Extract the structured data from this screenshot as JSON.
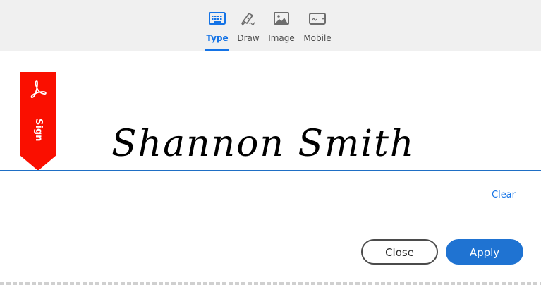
{
  "tabs": {
    "type": {
      "label": "Type",
      "icon": "keyboard-icon",
      "active": true
    },
    "draw": {
      "label": "Draw",
      "icon": "pen-icon",
      "active": false
    },
    "image": {
      "label": "Image",
      "icon": "image-icon",
      "active": false
    },
    "mobile": {
      "label": "Mobile",
      "icon": "mobile-icon",
      "active": false
    }
  },
  "ribbon": {
    "label": "Sign",
    "icon": "acrobat-logo-icon",
    "color": "#fa0f00"
  },
  "signature": {
    "text": "Shannon Smith"
  },
  "actions": {
    "clear_label": "Clear",
    "close_label": "Close",
    "apply_label": "Apply"
  },
  "colors": {
    "accent": "#1473e6",
    "apply_bg": "#1f73d2",
    "line": "#1f6fc5"
  }
}
